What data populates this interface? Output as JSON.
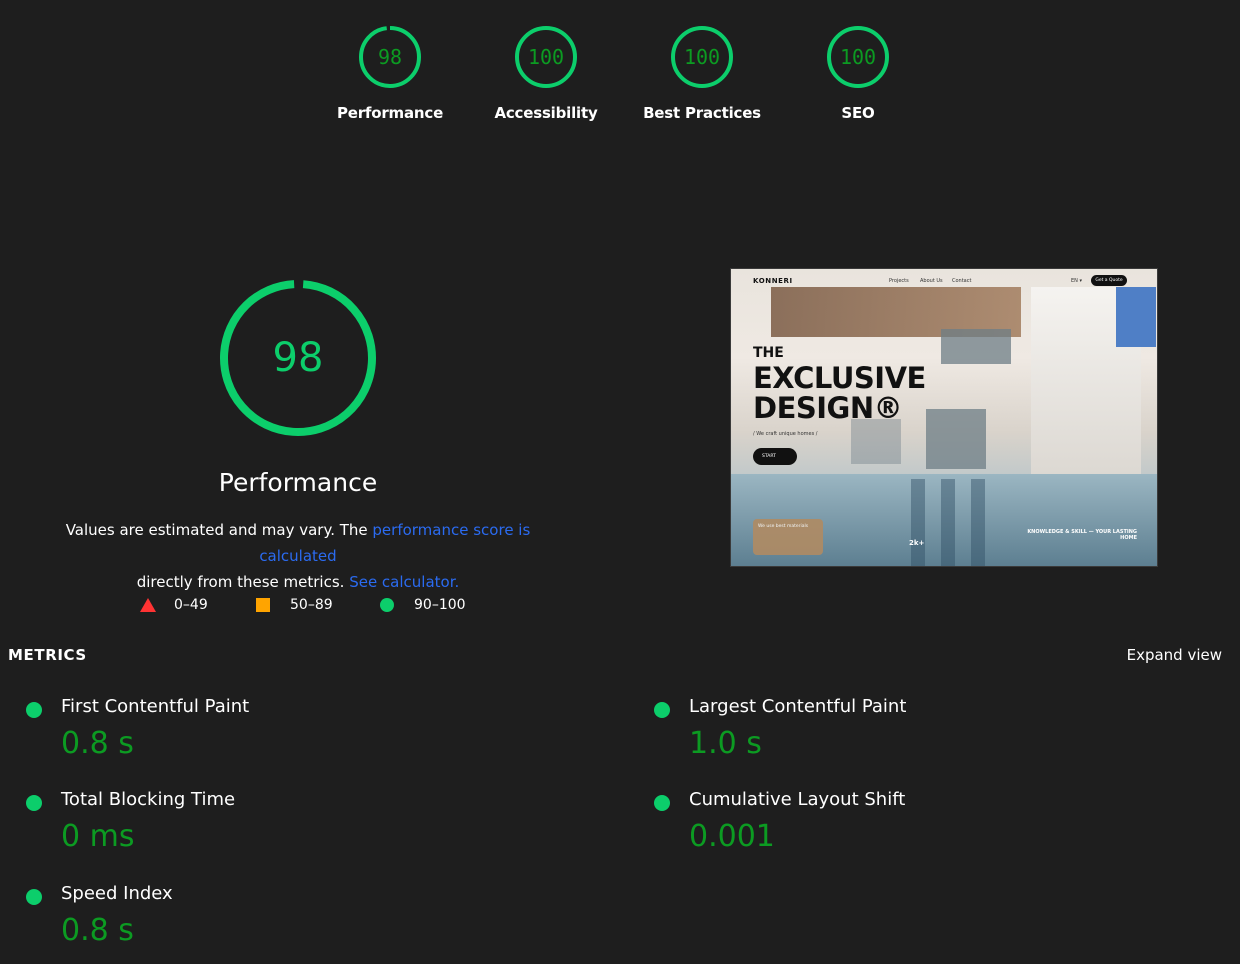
{
  "colors": {
    "background": "#1e1e1e",
    "pass_green": "#0cce6b",
    "value_green": "#0c9b22",
    "average_orange": "#ffa400",
    "fail_red": "#ff3333",
    "link_blue": "#2b6bf0"
  },
  "summary": {
    "categories": [
      {
        "label": "Performance",
        "score": "98"
      },
      {
        "label": "Accessibility",
        "score": "100"
      },
      {
        "label": "Best Practices",
        "score": "100"
      },
      {
        "label": "SEO",
        "score": "100"
      }
    ]
  },
  "performance": {
    "score": "98",
    "title": "Performance",
    "description_prefix": "Values are estimated and may vary. The ",
    "description_link": "performance score is calculated",
    "description_middle": " directly from these metrics. ",
    "calculator_link": "See calculator."
  },
  "legend": [
    {
      "icon": "fail-triangle-icon",
      "range": "0–49"
    },
    {
      "icon": "average-square-icon",
      "range": "50–89"
    },
    {
      "icon": "pass-circle-icon",
      "range": "90–100"
    }
  ],
  "preview": {
    "brand": "KONNERI",
    "menu": [
      "Projects",
      "About Us",
      "Contact"
    ],
    "lang": "EN ▾",
    "quote_button": "Get a Quote",
    "headline_1": "THE",
    "headline_2": "EXCLUSIVE",
    "headline_3": "DESIGN®",
    "tagline": "/ We craft unique homes /",
    "start_button": "START",
    "card_text": "We use best materials",
    "stats": "2k+",
    "slogan": "KNOWLEDGE & SKILL — YOUR LASTING HOME"
  },
  "metrics": {
    "title": "METRICS",
    "expand_label": "Expand view",
    "items": [
      {
        "name": "First Contentful Paint",
        "value": "0.8 s"
      },
      {
        "name": "Largest Contentful Paint",
        "value": "1.0 s"
      },
      {
        "name": "Total Blocking Time",
        "value": "0 ms"
      },
      {
        "name": "Cumulative Layout Shift",
        "value": "0.001"
      },
      {
        "name": "Speed Index",
        "value": "0.8 s"
      }
    ]
  }
}
